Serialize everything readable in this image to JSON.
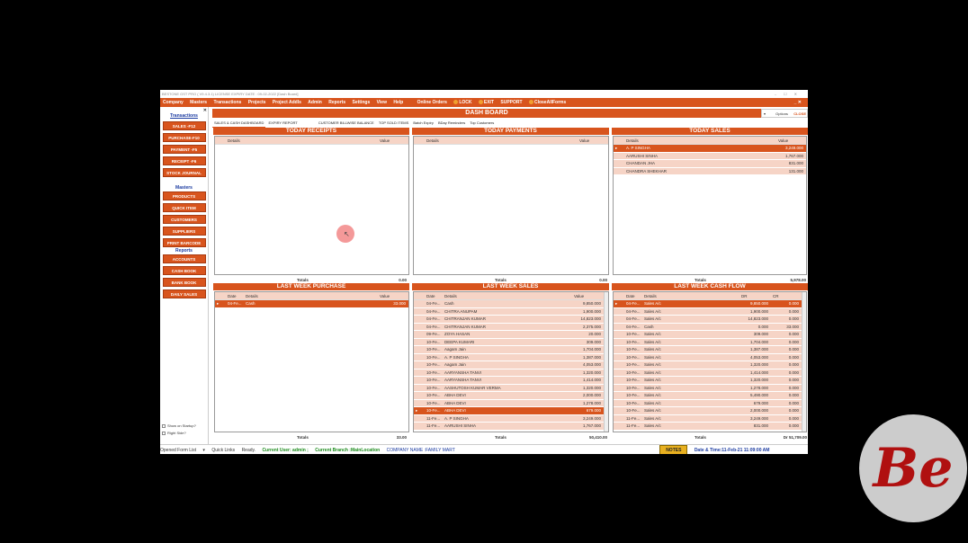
{
  "window": {
    "title": "BESTONE GST PRO ( V9.4.3.1)   LICENSE EXPIRY DATE : 09-02-2022   [Dash Board]"
  },
  "menu": {
    "items": [
      "Company",
      "Masters",
      "Transactions",
      "Projects",
      "Project Addls",
      "Admin",
      "Reports",
      "Settings",
      "View",
      "Help",
      "Online Orders"
    ],
    "lock": "LOCK",
    "exit": "EXIT",
    "support": "SUPPORT",
    "close_all": "CloseAllForms"
  },
  "sidebar": {
    "transactions_head": "Transactions",
    "transactions": [
      "SALES -F12",
      "PURCHASE-F10",
      "PAYMENT -F5",
      "RECEIPT -F6",
      "STOCK JOURNAL"
    ],
    "masters_head": "Masters",
    "masters": [
      "PRODUCTS",
      "QUICK ITEM",
      "CUSTOMERS",
      "SUPPLIERS",
      "PRINT BARCODE"
    ],
    "reports_head": "Reports",
    "reports": [
      "ACCOUNTS",
      "CASH BOOK",
      "BANK BOOK",
      "DAILY SALES"
    ],
    "show_startup": "Show on Startup?",
    "right_side": "Right Side?"
  },
  "dashboard": {
    "title": "DASH BOARD",
    "options": "Options",
    "close": "CLOSE"
  },
  "tabs": [
    "SALES & CASH DASHBOARD",
    "EXPIRY REPORT",
    "CUSTOMER BILLWISE BALANCE",
    "TOP SOLD ITEMS",
    "Batch Expiry",
    "BDay Reminders",
    "Top Customers"
  ],
  "today_receipts": {
    "title": "TODAY RECEIPTS",
    "col_details": "Details",
    "col_value": "Value",
    "totals_label": "Totals",
    "total": "0.00"
  },
  "today_payments": {
    "title": "TODAY PAYMENTS",
    "col_details": "Details",
    "col_value": "Value",
    "totals_label": "Totals",
    "total": "0.00"
  },
  "today_sales": {
    "title": "TODAY SALES",
    "col_details": "Details",
    "col_value": "Value",
    "rows": [
      {
        "details": "A. P SINGHA",
        "value": "3,249.000"
      },
      {
        "details": "AARUSHI SINHA",
        "value": "1,767.000"
      },
      {
        "details": "CHANDAN JHA",
        "value": "831.000"
      },
      {
        "details": "CHANDRA SHEKHAR",
        "value": "131.000"
      }
    ],
    "totals_label": "Totals",
    "total": "5,978.00"
  },
  "last_week_purchase": {
    "title": "LAST WEEK PURCHASE",
    "col_date": "Date",
    "col_details": "Details",
    "col_value": "Value",
    "rows": [
      {
        "date": "04-Fe...",
        "details": "Cash",
        "value": "33.000"
      }
    ],
    "totals_label": "Totals",
    "total": "33.00"
  },
  "last_week_sales": {
    "title": "LAST WEEK SALES",
    "col_date": "Date",
    "col_details": "Details",
    "col_value": "Value",
    "rows": [
      {
        "date": "04-Fe...",
        "details": "Cash",
        "value": "9,850.000"
      },
      {
        "date": "04-Fe...",
        "details": "CHITRA ANUPAM",
        "value": "1,900.000"
      },
      {
        "date": "04-Fe...",
        "details": "CHITRANJAN KUMAR",
        "value": "14,823.000"
      },
      {
        "date": "04-Fe...",
        "details": "CHITRANJAN KUMAR",
        "value": "2,375.000"
      },
      {
        "date": "09-Fe...",
        "details": "ZOYA HASAN",
        "value": "20.000"
      },
      {
        "date": "10-Fe...",
        "details": "DEEPA KUMARI",
        "value": "309.000"
      },
      {
        "date": "10-Fe...",
        "details": "Aagam Jain",
        "value": "1,704.000"
      },
      {
        "date": "10-Fe...",
        "details": "A. P SINGHA",
        "value": "1,387.000"
      },
      {
        "date": "10-Fe...",
        "details": "Aagam Jain",
        "value": "4,053.000"
      },
      {
        "date": "10-Fe...",
        "details": "AARYANSHA TANVI",
        "value": "1,320.000"
      },
      {
        "date": "10-Fe...",
        "details": "AARYANSHA TANVI",
        "value": "1,414.000"
      },
      {
        "date": "10-Fe...",
        "details": "AASHUTOSH KUMAR VERMA",
        "value": "1,320.000"
      },
      {
        "date": "10-Fe...",
        "details": "ABHA DEVI",
        "value": "2,000.000"
      },
      {
        "date": "10-Fe...",
        "details": "ABHA DEVI",
        "value": "1,278.000"
      },
      {
        "date": "10-Fe...",
        "details": "ABHA DEVI",
        "value": "679.000"
      },
      {
        "date": "11-Fe...",
        "details": "A. P SINGHA",
        "value": "3,249.000"
      },
      {
        "date": "11-Fe...",
        "details": "AARUSHI SINHA",
        "value": "1,767.000"
      }
    ],
    "selected_index": 14,
    "totals_label": "Totals",
    "total": "50,410.00"
  },
  "last_week_cash_flow": {
    "title": "LAST WEEK CASH FLOW",
    "col_date": "Date",
    "col_details": "Details",
    "col_dr": "DR",
    "col_cr": "CR",
    "rows": [
      {
        "date": "04-Fe...",
        "details": "Sales A/c",
        "dr": "9,850.000",
        "cr": "0.000"
      },
      {
        "date": "04-Fe...",
        "details": "Sales A/c",
        "dr": "1,900.000",
        "cr": "0.000"
      },
      {
        "date": "04-Fe...",
        "details": "Sales A/c",
        "dr": "14,823.000",
        "cr": "0.000"
      },
      {
        "date": "04-Fe...",
        "details": "Cash",
        "dr": "0.000",
        "cr": "33.000"
      },
      {
        "date": "10-Fe...",
        "details": "Sales A/c",
        "dr": "309.000",
        "cr": "0.000"
      },
      {
        "date": "10-Fe...",
        "details": "Sales A/c",
        "dr": "1,704.000",
        "cr": "0.000"
      },
      {
        "date": "10-Fe...",
        "details": "Sales A/c",
        "dr": "1,387.000",
        "cr": "0.000"
      },
      {
        "date": "10-Fe...",
        "details": "Sales A/c",
        "dr": "4,053.000",
        "cr": "0.000"
      },
      {
        "date": "10-Fe...",
        "details": "Sales A/c",
        "dr": "1,320.000",
        "cr": "0.000"
      },
      {
        "date": "10-Fe...",
        "details": "Sales A/c",
        "dr": "1,414.000",
        "cr": "0.000"
      },
      {
        "date": "10-Fe...",
        "details": "Sales A/c",
        "dr": "1,320.000",
        "cr": "0.000"
      },
      {
        "date": "10-Fe...",
        "details": "Sales A/c",
        "dr": "1,278.000",
        "cr": "0.000"
      },
      {
        "date": "10-Fe...",
        "details": "Sales A/c",
        "dr": "5,490.000",
        "cr": "0.000"
      },
      {
        "date": "10-Fe...",
        "details": "Sales A/c",
        "dr": "679.000",
        "cr": "0.000"
      },
      {
        "date": "10-Fe...",
        "details": "Sales A/c",
        "dr": "2,000.000",
        "cr": "0.000"
      },
      {
        "date": "11-Fe...",
        "details": "Sales A/c",
        "dr": "3,249.000",
        "cr": "0.000"
      },
      {
        "date": "11-Fe...",
        "details": "Sales A/c",
        "dr": "831.000",
        "cr": "0.000"
      }
    ],
    "totals_label": "Totals",
    "total": "Dr 51,709.00"
  },
  "status": {
    "form_list": "Opened Form List",
    "quick_links": "Quick Links",
    "ready": "Ready.",
    "user": "Current User: admin ;",
    "branch": "Current Branch :MainLocation",
    "company": "COMPANY NAME :FAMILY MART",
    "notes": "NOTES",
    "datetime": "Date & Time:11-Feb-21 11:09:00 AM"
  },
  "watermark": {
    "text": "Be"
  },
  "colors": {
    "accent": "#d8541d",
    "row_bg": "#f6d4c6",
    "sidebar_head": "#1a3aa0"
  }
}
